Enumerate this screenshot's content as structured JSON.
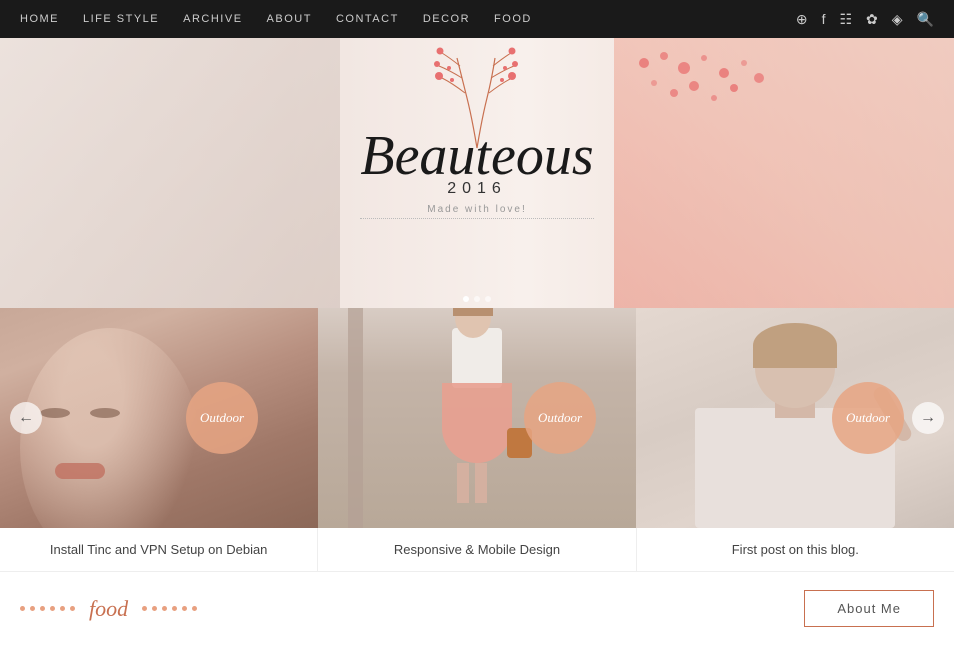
{
  "nav": {
    "links": [
      {
        "label": "HOME",
        "id": "home"
      },
      {
        "label": "LIFE STYLE",
        "id": "lifestyle"
      },
      {
        "label": "ARCHIVE",
        "id": "archive"
      },
      {
        "label": "ABOUT",
        "id": "about"
      },
      {
        "label": "CONTACT",
        "id": "contact"
      },
      {
        "label": "DECOR",
        "id": "decor"
      },
      {
        "label": "FOOD",
        "id": "food"
      }
    ],
    "icons": [
      "⊕",
      "f",
      "☷",
      "✿",
      "☏",
      "🔍"
    ]
  },
  "hero": {
    "logo": "Beauteous",
    "year": "2016",
    "subtitle": "Made with love!"
  },
  "cards": [
    {
      "badge": "Outdoor",
      "title": "Install Tinc and VPN Setup on Debian"
    },
    {
      "badge": "Outdoor",
      "title": "Responsive & Mobile Design"
    },
    {
      "badge": "Outdoor",
      "title": "First post on this blog."
    }
  ],
  "footer": {
    "food_label": "food",
    "about_button": "About Me"
  }
}
